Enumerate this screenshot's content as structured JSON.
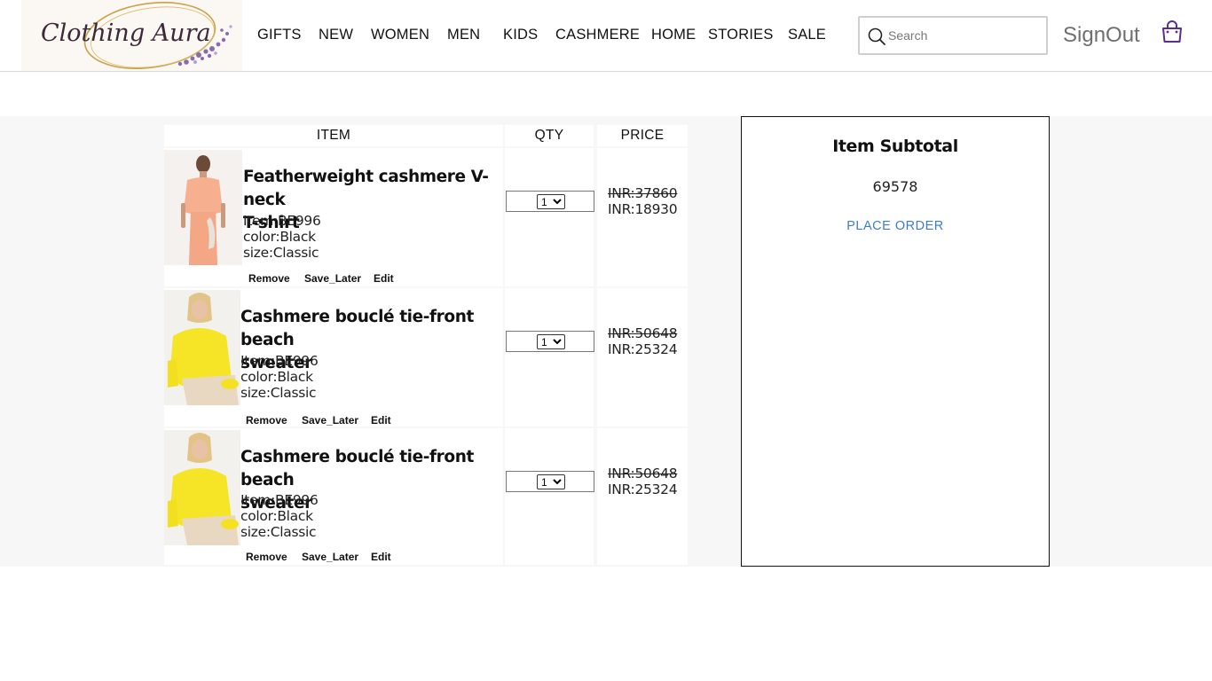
{
  "brand": {
    "logo_text": "Clothing Aura"
  },
  "nav": {
    "items": [
      {
        "label": "GIFTS"
      },
      {
        "label": "NEW"
      },
      {
        "label": "WOMEN"
      },
      {
        "label": "MEN"
      },
      {
        "label": "KIDS"
      },
      {
        "label": "CASHMERE"
      },
      {
        "label": "HOME"
      },
      {
        "label": "STORIES"
      },
      {
        "label": "SALE"
      }
    ]
  },
  "search": {
    "placeholder": "Search",
    "value": ""
  },
  "account": {
    "signout_label": "SignOut"
  },
  "icons": {
    "search": "search-icon",
    "bag": "shopping-bag-icon"
  },
  "colors": {
    "accent_link": "#3d7cc9",
    "bag_icon": "#5b2d8e",
    "band_bg": "#f7f7f7"
  },
  "cart": {
    "headers": {
      "item": "ITEM",
      "qty": "QTY",
      "price": "PRICE"
    },
    "rows": [
      {
        "name_line1": "Featherweight cashmere V-neck",
        "name_line2": "T-shirt",
        "item": "Item:BE996",
        "color": "color:Black",
        "size": "size:Classic",
        "qty": "1",
        "price_old": "INR:37860",
        "price_new": "INR:18930",
        "actions": {
          "remove": "Remove",
          "save_later": "Save_Later",
          "edit": "Edit"
        }
      },
      {
        "name_line1": "Cashmere bouclé tie-front beach",
        "name_line2": "sweater",
        "item": "Item:BE996",
        "color": "color:Black",
        "size": "size:Classic",
        "qty": "1",
        "price_old": "INR:50648",
        "price_new": "INR:25324",
        "actions": {
          "remove": "Remove",
          "save_later": "Save_Later",
          "edit": "Edit"
        }
      },
      {
        "name_line1": "Cashmere bouclé tie-front beach",
        "name_line2": "sweater",
        "item": "Item:BE996",
        "color": "color:Black",
        "size": "size:Classic",
        "qty": "1",
        "price_old": "INR:50648",
        "price_new": "INR:25324",
        "actions": {
          "remove": "Remove",
          "save_later": "Save_Later",
          "edit": "Edit"
        }
      }
    ]
  },
  "summary": {
    "title": "Item Subtotal",
    "subtotal": "69578",
    "place_order_label": "PLACE ORDER"
  }
}
